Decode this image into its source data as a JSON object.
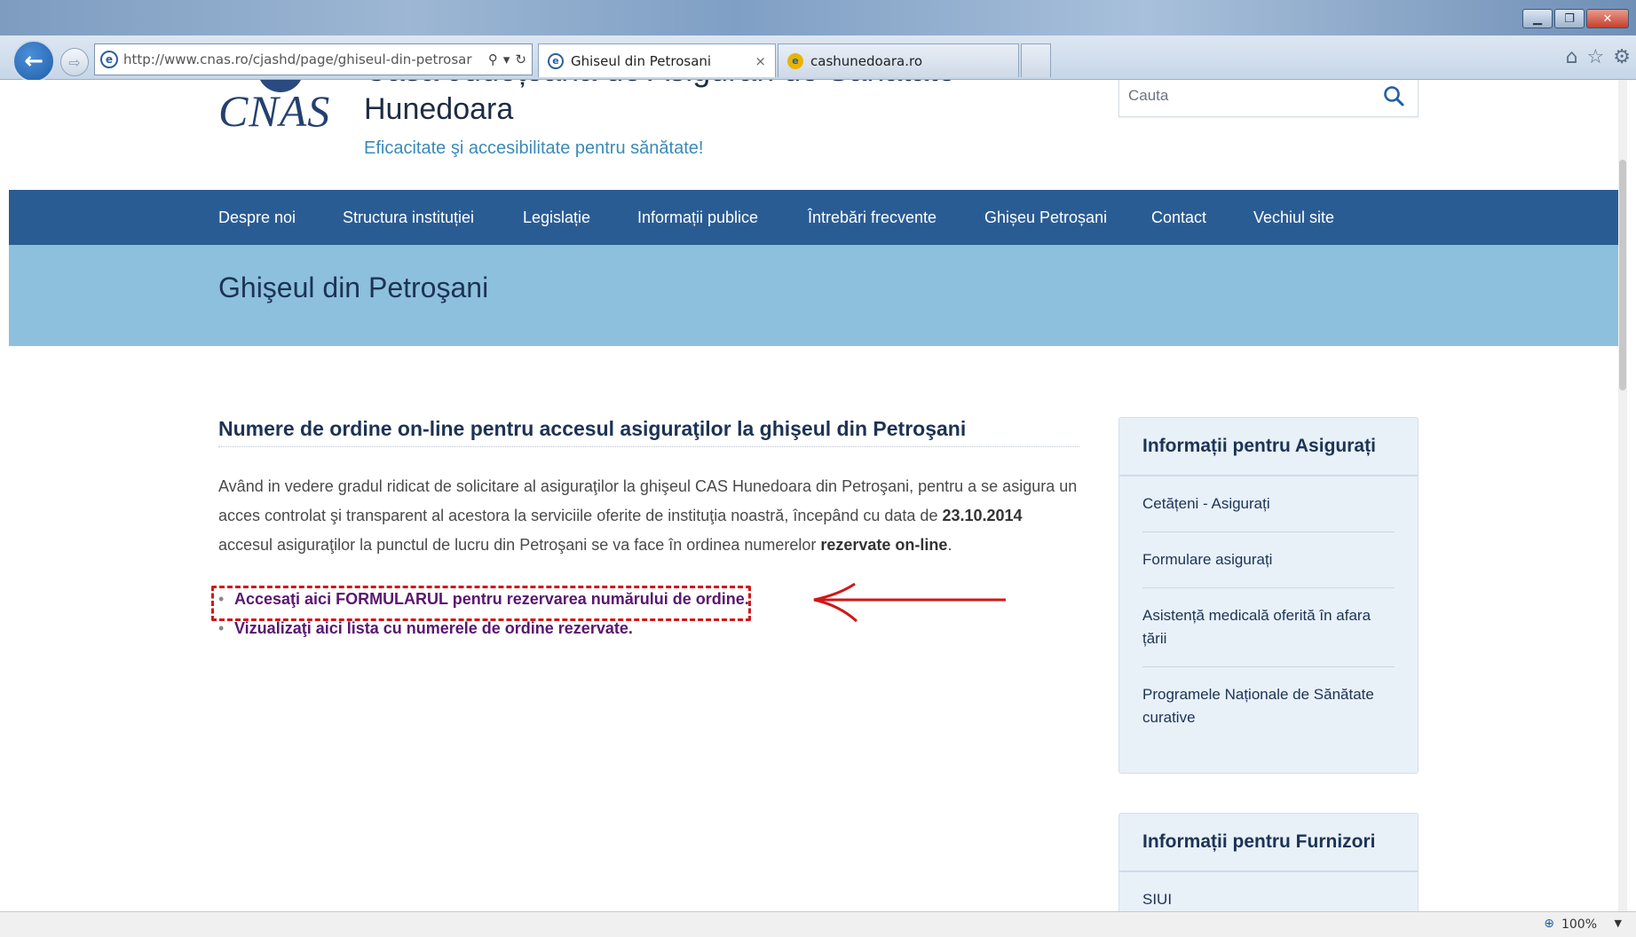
{
  "browser": {
    "url": "http://www.cnas.ro/cjashd/page/ghiseul-din-petrosar",
    "url_icons": {
      "search": "⚲",
      "dropdown": "▾",
      "refresh": "↻"
    },
    "tabs": [
      {
        "label": "Ghiseul din Petrosani",
        "close": "×",
        "icon": "ie-icon",
        "active": true
      },
      {
        "label": "cashunedoara.ro",
        "icon": "ie-icon",
        "active": false
      }
    ],
    "window_controls": [
      "minimize",
      "restore",
      "close"
    ],
    "toolbar_icons": [
      "home-icon",
      "favorites-icon",
      "settings-icon"
    ],
    "zoom": "100%"
  },
  "site": {
    "logo_text": "CNAS",
    "org_name_partial": "Casa Județeană de Asigurări de Sănătate",
    "org_name": "Hunedoara",
    "tagline": "Eficacitate şi accesibilitate pentru sănătate!",
    "search_placeholder": "Cauta"
  },
  "nav": {
    "items": [
      {
        "label": "Despre noi"
      },
      {
        "label": "Structura instituției"
      },
      {
        "label": "Legislație"
      },
      {
        "label": "Informații publice"
      },
      {
        "label": "Întrebări frecvente"
      },
      {
        "label": "Ghișeu Petroșani"
      },
      {
        "label": "Contact"
      },
      {
        "label": "Vechiul site"
      }
    ]
  },
  "page": {
    "title": "Ghişeul din Petroşani"
  },
  "article": {
    "heading": "Numere de ordine on-line pentru accesul asiguraţilor la ghişeul din Petroşani",
    "body_part1": "Având in vedere gradul ridicat de solicitare al asiguraţilor la ghişeul CAS Hunedoara din Petroşani, pentru a se asigura un acces controlat şi transparent al acestora la serviciile oferite de instituţia noastră, începând cu data de ",
    "body_date": "23.10.2014",
    "body_part2": " accesul asiguraţilor la punctul de lucru din Petroşani se va face în ordinea numerelor ",
    "body_bold": "rezervate on-line",
    "body_end": ".",
    "bullet": "•",
    "links": [
      "Accesaţi aici FORMULARUL pentru rezervarea numărului de ordine.",
      "Vizualizaţi aici lista cu numerele de ordine rezervate."
    ]
  },
  "sidebar": {
    "asigurati": {
      "heading": "Informații pentru Asigurați",
      "items": [
        "Cetățeni - Asigurați",
        "Formulare asigurați",
        "Asistență medicală oferită în afara țării",
        "Programele Naționale de Sănătate curative"
      ]
    },
    "furnizori": {
      "heading": "Informații pentru Furnizori",
      "items": [
        "SIUI"
      ]
    }
  },
  "colors": {
    "nav_bg": "#2a5c94",
    "title_band": "#8dc0dc",
    "link_visited": "#5a1670",
    "annotation": "#d01818",
    "sidebar_bg": "#e8f0f8"
  }
}
